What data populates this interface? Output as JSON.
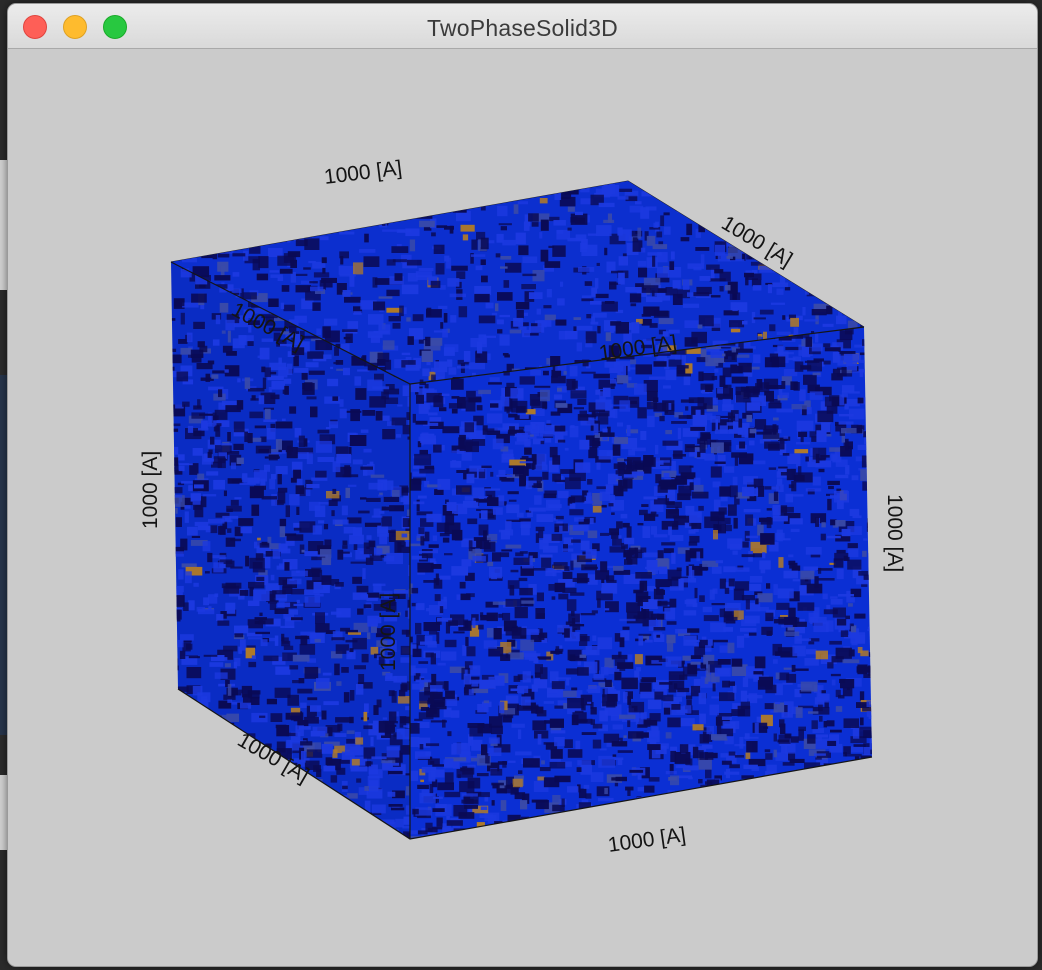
{
  "window": {
    "title": "TwoPhaseSolid3D"
  },
  "plot": {
    "axis_labels": [
      {
        "id": "top-back",
        "text": "1000 [A]"
      },
      {
        "id": "top-right",
        "text": "1000 [A]"
      },
      {
        "id": "top-left-inner",
        "text": "1000 [A]"
      },
      {
        "id": "top-front-inner",
        "text": "1000 [A]"
      },
      {
        "id": "left-vertical",
        "text": "1000 [A]"
      },
      {
        "id": "right-vertical",
        "text": "1000 [A]"
      },
      {
        "id": "front-vertical",
        "text": "1000 [A]"
      },
      {
        "id": "bottom-left",
        "text": "1000 [A]"
      },
      {
        "id": "bottom-front",
        "text": "1000 [A]"
      }
    ],
    "colors": {
      "phase_solid": "#0b2fd4",
      "phase_pore": "#0a0a55",
      "highlight": "#b07a28",
      "background": "#cbcbcb"
    }
  }
}
